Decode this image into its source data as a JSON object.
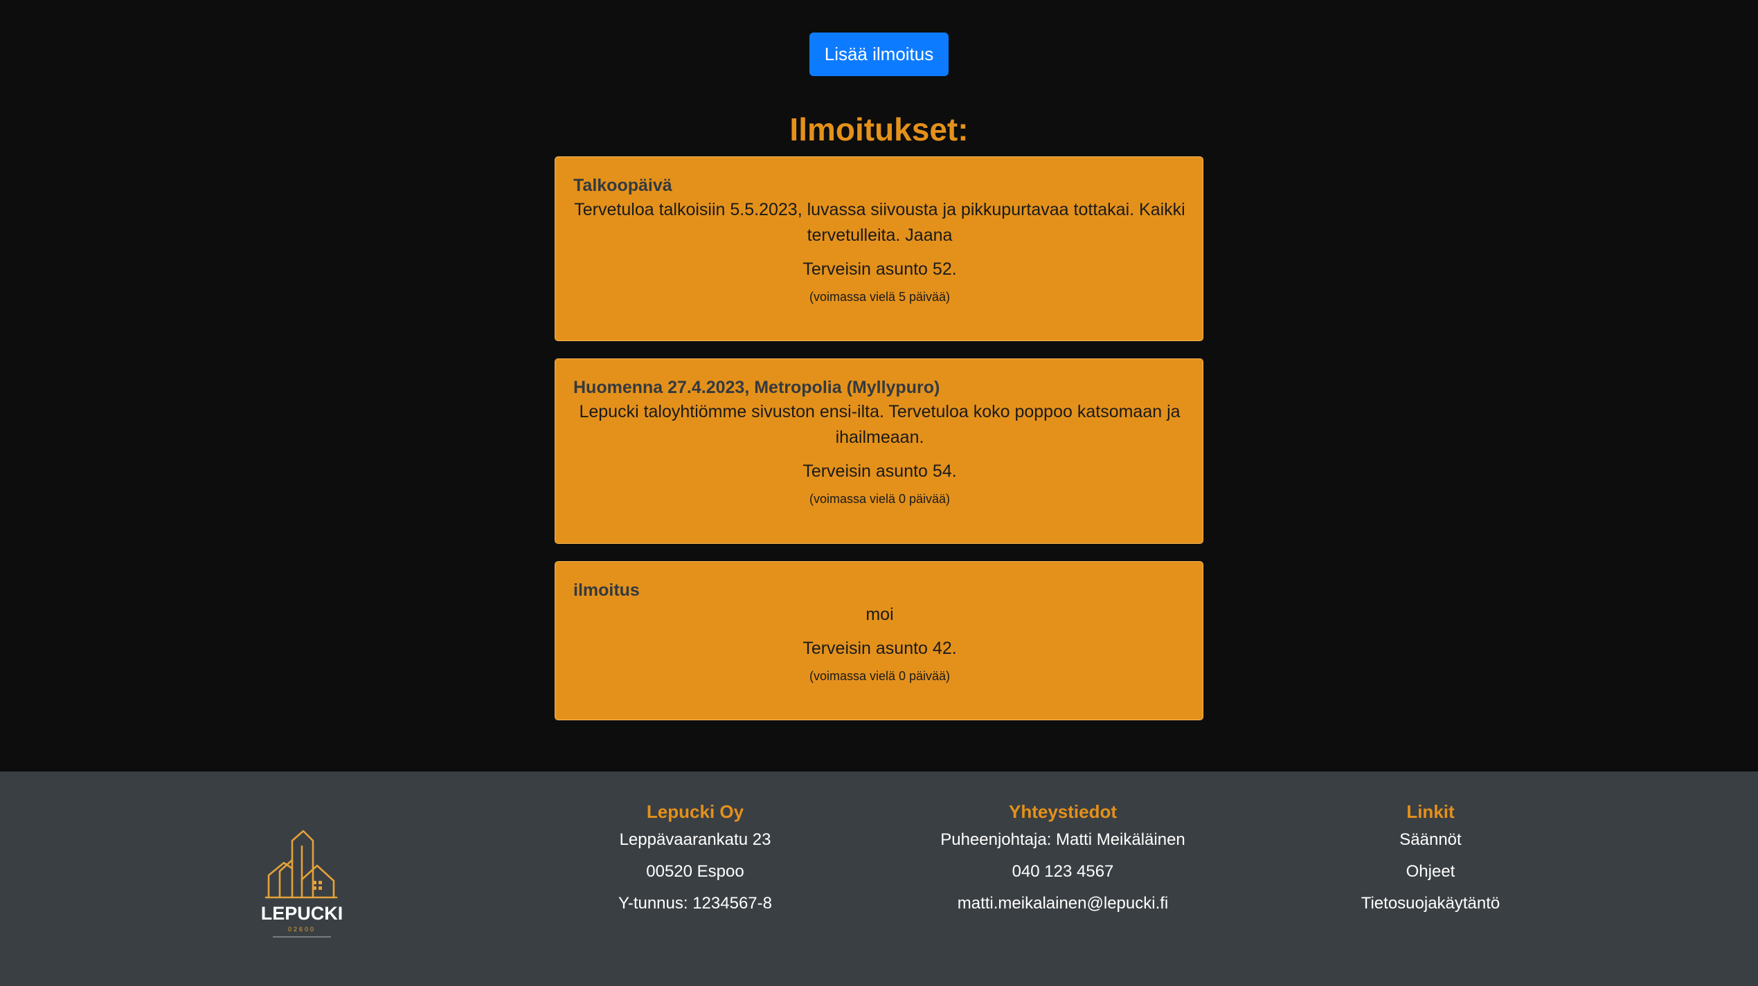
{
  "header": {
    "add_button_label": "Lisää ilmoitus",
    "section_title": "Ilmoitukset:"
  },
  "notices": [
    {
      "title": "Talkoopäivä",
      "body": "Tervetuloa talkoisiin 5.5.2023, luvassa siivousta ja pikkupurtavaa tottakai. Kaikki tervetulleita. Jaana",
      "signature": "Terveisin asunto 52.",
      "validity": "(voimassa vielä 5 päivää)"
    },
    {
      "title": "Huomenna 27.4.2023, Metropolia (Myllypuro)",
      "body": "Lepucki taloyhtiömme sivuston ensi-ilta. Tervetuloa koko poppoo katsomaan ja ihailmeaan.",
      "signature": "Terveisin asunto 54.",
      "validity": "(voimassa vielä 0 päivää)"
    },
    {
      "title": "ilmoitus",
      "body": "moi",
      "signature": "Terveisin asunto 42.",
      "validity": "(voimassa vielä 0 päivää)"
    }
  ],
  "footer": {
    "logo": {
      "name": "LEPUCKI",
      "postcode": "02600",
      "icon": "building-logo-icon"
    },
    "company": {
      "title": "Lepucki Oy",
      "lines": [
        "Leppävaarankatu 23",
        "00520 Espoo",
        "Y-tunnus: 1234567-8"
      ]
    },
    "contact": {
      "title": "Yhteystiedot",
      "lines": [
        "Puheenjohtaja: Matti Meikäläinen",
        "040 123 4567",
        "matti.meikalainen@lepucki.fi"
      ]
    },
    "links": {
      "title": "Linkit",
      "items": [
        "Säännöt",
        "Ohjeet",
        "Tietosuojakäytäntö"
      ]
    }
  },
  "colors": {
    "background": "#0d0d0d",
    "accent": "#e4911b",
    "button": "#0d7bff",
    "footer": "#3a3f43"
  }
}
